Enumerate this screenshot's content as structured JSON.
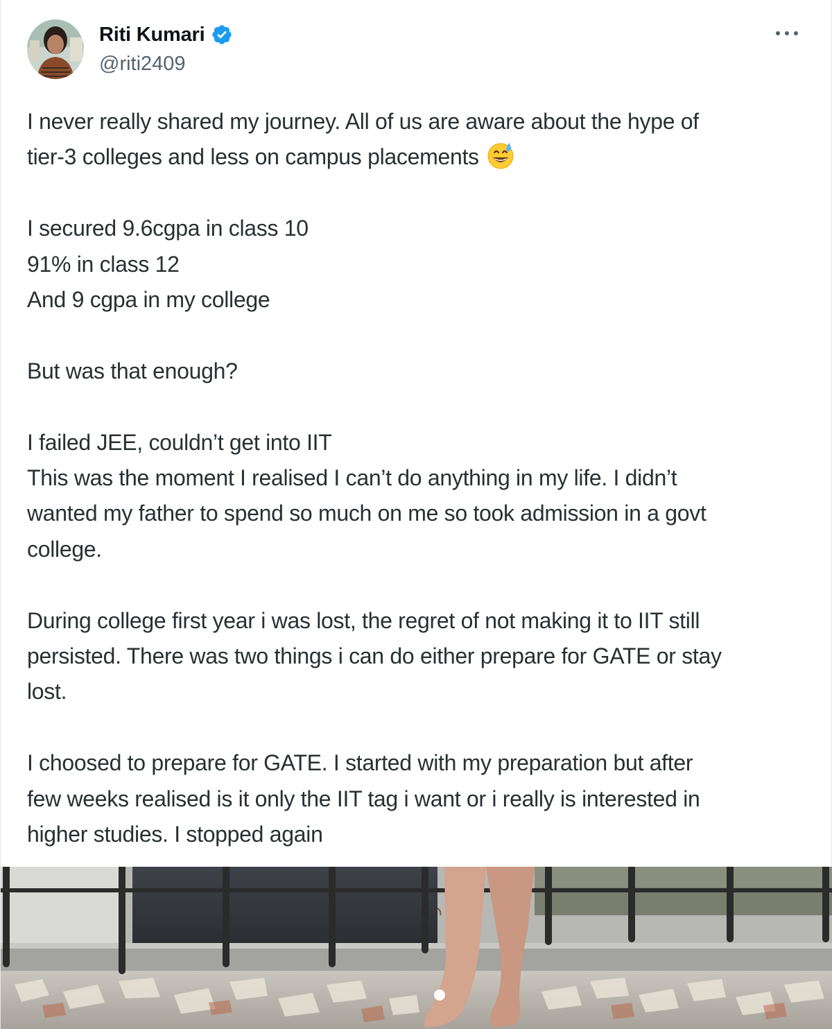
{
  "author": {
    "display_name": "Riti Kumari",
    "handle": "@riti2409",
    "verified": true,
    "verified_color": "#1d9bf0"
  },
  "menu": {
    "icon": "more-horizontal-icon"
  },
  "post": {
    "paragraphs": [
      {
        "lines": [
          "I never really shared my journey. All of us are aware about the hype of",
          "tier-3 colleges and less on campus placements"
        ],
        "emoji": "grinning-sweat-emoji"
      },
      {
        "lines": [
          "I secured 9.6cgpa in class 10",
          "91% in class 12",
          "And 9 cgpa in my college"
        ]
      },
      {
        "lines": [
          "But was that enough?"
        ]
      },
      {
        "lines": [
          "I failed JEE, couldn’t get into IIT",
          "This was the moment I realised I can’t do anything in my life. I didn’t",
          "wanted my father to spend so much on me so took admission in a govt",
          "college."
        ]
      },
      {
        "lines": [
          "During college first year i was lost, the regret of not making it to IIT still",
          "persisted. There was two things i can do either prepare for GATE or stay",
          "lost."
        ]
      },
      {
        "lines": [
          "I choosed to prepare for GATE. I started with my preparation but after",
          "few weeks realised is it only the IIT tag i want or i really is interested in",
          "higher studies. I stopped again"
        ]
      }
    ]
  },
  "media": {
    "type": "photo",
    "carousel_pages": 1,
    "active_page": 1
  }
}
